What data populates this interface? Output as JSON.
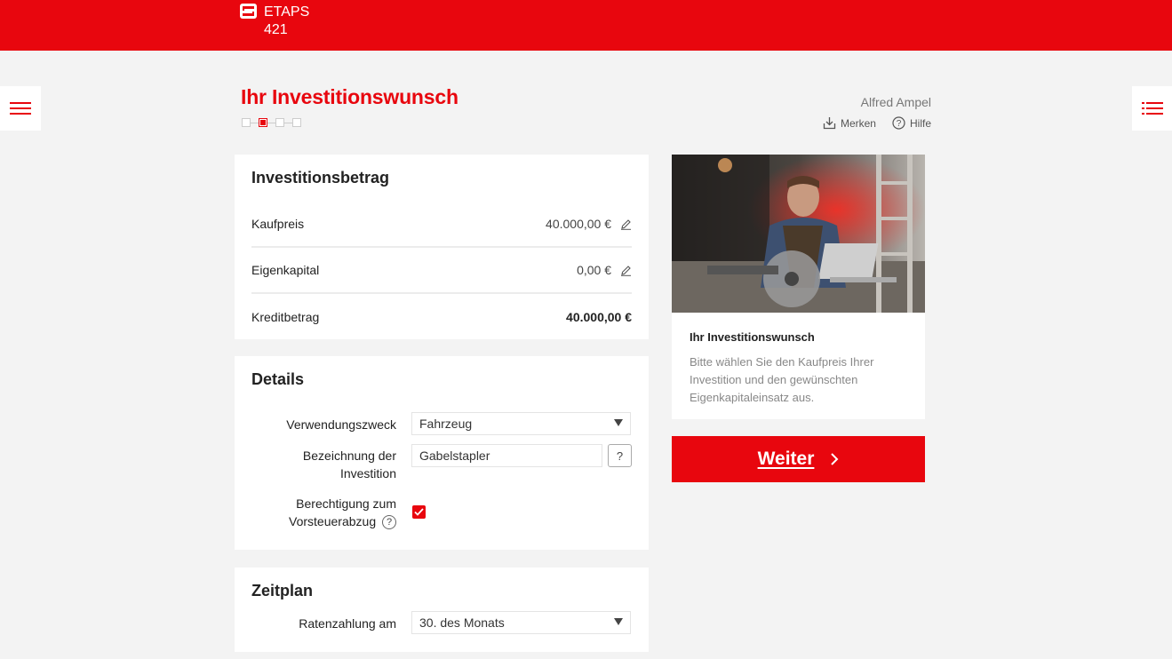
{
  "header": {
    "brand_line1": "ETAPS",
    "brand_line2": "421"
  },
  "page": {
    "title": "Ihr Investitionswunsch",
    "steps_total": 4,
    "steps_active": 2
  },
  "user": {
    "name": "Alfred Ampel",
    "save_label": "Merken",
    "help_label": "Hilfe"
  },
  "investment": {
    "title": "Investitionsbetrag",
    "rows": [
      {
        "label": "Kaufpreis",
        "value": "40.000,00 €"
      },
      {
        "label": "Eigenkapital",
        "value": "0,00 €"
      },
      {
        "label": "Kreditbetrag",
        "value": "40.000,00 €"
      }
    ]
  },
  "details": {
    "title": "Details",
    "purpose_label": "Verwendungszweck",
    "purpose_value": "Fahrzeug",
    "name_label_line1": "Bezeichnung der",
    "name_label_line2": "Investition",
    "name_value": "Gabelstapler",
    "question_mark": "?",
    "vat_label_line1": "Berechtigung zum",
    "vat_label_line2": "Vorsteuerabzug",
    "vat_checked": true
  },
  "schedule": {
    "title": "Zeitplan",
    "rate_label": "Ratenzahlung am",
    "rate_value": "30. des Monats"
  },
  "info": {
    "title": "Ihr Investitionswunsch",
    "text": "Bitte wählen Sie den Kaufpreis Ihrer Investition und den gewünschten Eigenkapitaleinsatz aus."
  },
  "next_button": {
    "label": "Weiter"
  },
  "colors": {
    "brand_red": "#e8060e",
    "background": "#f3f3f3"
  }
}
